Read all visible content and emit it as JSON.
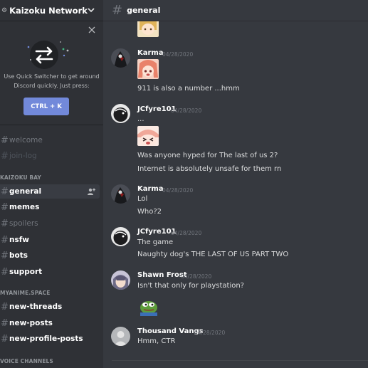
{
  "server": {
    "name": "Kaizoku Network",
    "icon": "compass-icon"
  },
  "switcher": {
    "text_line1": "Use Quick Switcher to get around",
    "text_line2": "Discord quickly. Just press:",
    "button": "CTRL + K"
  },
  "channels_top": [
    {
      "name": "welcome"
    },
    {
      "name": "join-log"
    }
  ],
  "categories": [
    {
      "name": "KAIZOKU BAY"
    },
    {
      "name": "MYANIME.SPACE"
    },
    {
      "name": "VOICE CHANNELS"
    }
  ],
  "channels_bay": [
    {
      "name": "general"
    },
    {
      "name": "memes"
    },
    {
      "name": "spoilers"
    },
    {
      "name": "nsfw"
    },
    {
      "name": "bots"
    },
    {
      "name": "support"
    }
  ],
  "channels_space": [
    {
      "name": "new-threads"
    },
    {
      "name": "new-posts"
    },
    {
      "name": "new-profile-posts"
    }
  ],
  "header": {
    "channel": "general"
  },
  "messages": [
    {
      "author": "Karma",
      "timestamp": "04/28/2020",
      "lines": [
        "911 is also a number ...hmm"
      ]
    },
    {
      "author": "JCfyre101",
      "timestamp": "04/28/2020",
      "lines": [
        "...",
        "Was anyone hyped for The last of us 2?",
        "Internet is absolutely unsafe for them rn"
      ]
    },
    {
      "author": "Karma",
      "timestamp": "04/28/2020",
      "lines": [
        "Lol",
        "Who?2"
      ]
    },
    {
      "author": "JCfyre101",
      "timestamp": "04/28/2020",
      "lines": [
        "The game",
        "Naughty dog's THE LAST OF US PART TWO"
      ]
    },
    {
      "author": "Shawn Frost",
      "timestamp": "04/28/2020",
      "lines": [
        "Isn't that only for playstation?"
      ]
    },
    {
      "author": "Thousand Vangs",
      "timestamp": "04/28/2020",
      "lines": [
        "Hmm, CTR"
      ]
    }
  ],
  "colors": {
    "accent": "#7289da",
    "sidebar_bg": "#2f3136",
    "main_bg": "#36393f"
  }
}
